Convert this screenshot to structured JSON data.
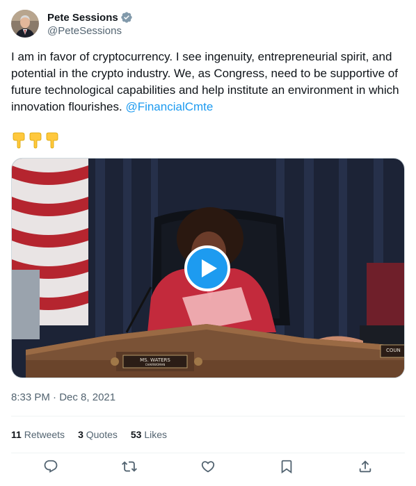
{
  "author": {
    "display_name": "Pete Sessions",
    "handle": "@PeteSessions",
    "verified": true,
    "verified_color": "#1d9bf0"
  },
  "tweet": {
    "text": "I am in favor of cryptocurrency. I see ingenuity, entrepreneurial spirit, and potential in the crypto industry. We, as Congress, need to be supportive of future technological capabilities and help institute an environment in which innovation flourishes. ",
    "mention": "@FinancialCmte",
    "emoji": [
      "point-down-emoji",
      "point-down-emoji",
      "point-down-emoji"
    ]
  },
  "media": {
    "type": "video",
    "nameplate_name": "MS. WATERS",
    "nameplate_title": "CHAIRWOMAN",
    "nameplate_right": "COUN"
  },
  "timestamp": {
    "time": "8:33 PM",
    "separator": " · ",
    "date": "Dec 8, 2021"
  },
  "stats": {
    "retweets": {
      "count": "11",
      "label": "Retweets"
    },
    "quotes": {
      "count": "3",
      "label": "Quotes"
    },
    "likes": {
      "count": "53",
      "label": "Likes"
    }
  },
  "actions": [
    "reply-icon",
    "retweet-icon",
    "like-icon",
    "bookmark-icon",
    "share-icon"
  ],
  "colors": {
    "accent": "#1d9bf0",
    "text_primary": "#0f1419",
    "text_secondary": "#536471",
    "divider": "#eff3f4"
  }
}
